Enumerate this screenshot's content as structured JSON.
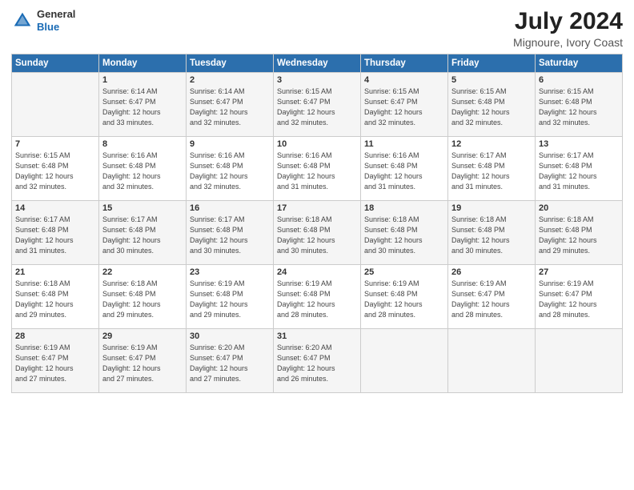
{
  "logo": {
    "general": "General",
    "blue": "Blue"
  },
  "title": "July 2024",
  "location": "Mignoure, Ivory Coast",
  "days_of_week": [
    "Sunday",
    "Monday",
    "Tuesday",
    "Wednesday",
    "Thursday",
    "Friday",
    "Saturday"
  ],
  "weeks": [
    [
      {
        "day": "",
        "sunrise": "",
        "sunset": "",
        "daylight": ""
      },
      {
        "day": "1",
        "sunrise": "Sunrise: 6:14 AM",
        "sunset": "Sunset: 6:47 PM",
        "daylight": "Daylight: 12 hours and 33 minutes."
      },
      {
        "day": "2",
        "sunrise": "Sunrise: 6:14 AM",
        "sunset": "Sunset: 6:47 PM",
        "daylight": "Daylight: 12 hours and 32 minutes."
      },
      {
        "day": "3",
        "sunrise": "Sunrise: 6:15 AM",
        "sunset": "Sunset: 6:47 PM",
        "daylight": "Daylight: 12 hours and 32 minutes."
      },
      {
        "day": "4",
        "sunrise": "Sunrise: 6:15 AM",
        "sunset": "Sunset: 6:47 PM",
        "daylight": "Daylight: 12 hours and 32 minutes."
      },
      {
        "day": "5",
        "sunrise": "Sunrise: 6:15 AM",
        "sunset": "Sunset: 6:48 PM",
        "daylight": "Daylight: 12 hours and 32 minutes."
      },
      {
        "day": "6",
        "sunrise": "Sunrise: 6:15 AM",
        "sunset": "Sunset: 6:48 PM",
        "daylight": "Daylight: 12 hours and 32 minutes."
      }
    ],
    [
      {
        "day": "7",
        "sunrise": "Sunrise: 6:15 AM",
        "sunset": "Sunset: 6:48 PM",
        "daylight": "Daylight: 12 hours and 32 minutes."
      },
      {
        "day": "8",
        "sunrise": "Sunrise: 6:16 AM",
        "sunset": "Sunset: 6:48 PM",
        "daylight": "Daylight: 12 hours and 32 minutes."
      },
      {
        "day": "9",
        "sunrise": "Sunrise: 6:16 AM",
        "sunset": "Sunset: 6:48 PM",
        "daylight": "Daylight: 12 hours and 32 minutes."
      },
      {
        "day": "10",
        "sunrise": "Sunrise: 6:16 AM",
        "sunset": "Sunset: 6:48 PM",
        "daylight": "Daylight: 12 hours and 31 minutes."
      },
      {
        "day": "11",
        "sunrise": "Sunrise: 6:16 AM",
        "sunset": "Sunset: 6:48 PM",
        "daylight": "Daylight: 12 hours and 31 minutes."
      },
      {
        "day": "12",
        "sunrise": "Sunrise: 6:17 AM",
        "sunset": "Sunset: 6:48 PM",
        "daylight": "Daylight: 12 hours and 31 minutes."
      },
      {
        "day": "13",
        "sunrise": "Sunrise: 6:17 AM",
        "sunset": "Sunset: 6:48 PM",
        "daylight": "Daylight: 12 hours and 31 minutes."
      }
    ],
    [
      {
        "day": "14",
        "sunrise": "Sunrise: 6:17 AM",
        "sunset": "Sunset: 6:48 PM",
        "daylight": "Daylight: 12 hours and 31 minutes."
      },
      {
        "day": "15",
        "sunrise": "Sunrise: 6:17 AM",
        "sunset": "Sunset: 6:48 PM",
        "daylight": "Daylight: 12 hours and 30 minutes."
      },
      {
        "day": "16",
        "sunrise": "Sunrise: 6:17 AM",
        "sunset": "Sunset: 6:48 PM",
        "daylight": "Daylight: 12 hours and 30 minutes."
      },
      {
        "day": "17",
        "sunrise": "Sunrise: 6:18 AM",
        "sunset": "Sunset: 6:48 PM",
        "daylight": "Daylight: 12 hours and 30 minutes."
      },
      {
        "day": "18",
        "sunrise": "Sunrise: 6:18 AM",
        "sunset": "Sunset: 6:48 PM",
        "daylight": "Daylight: 12 hours and 30 minutes."
      },
      {
        "day": "19",
        "sunrise": "Sunrise: 6:18 AM",
        "sunset": "Sunset: 6:48 PM",
        "daylight": "Daylight: 12 hours and 30 minutes."
      },
      {
        "day": "20",
        "sunrise": "Sunrise: 6:18 AM",
        "sunset": "Sunset: 6:48 PM",
        "daylight": "Daylight: 12 hours and 29 minutes."
      }
    ],
    [
      {
        "day": "21",
        "sunrise": "Sunrise: 6:18 AM",
        "sunset": "Sunset: 6:48 PM",
        "daylight": "Daylight: 12 hours and 29 minutes."
      },
      {
        "day": "22",
        "sunrise": "Sunrise: 6:18 AM",
        "sunset": "Sunset: 6:48 PM",
        "daylight": "Daylight: 12 hours and 29 minutes."
      },
      {
        "day": "23",
        "sunrise": "Sunrise: 6:19 AM",
        "sunset": "Sunset: 6:48 PM",
        "daylight": "Daylight: 12 hours and 29 minutes."
      },
      {
        "day": "24",
        "sunrise": "Sunrise: 6:19 AM",
        "sunset": "Sunset: 6:48 PM",
        "daylight": "Daylight: 12 hours and 28 minutes."
      },
      {
        "day": "25",
        "sunrise": "Sunrise: 6:19 AM",
        "sunset": "Sunset: 6:48 PM",
        "daylight": "Daylight: 12 hours and 28 minutes."
      },
      {
        "day": "26",
        "sunrise": "Sunrise: 6:19 AM",
        "sunset": "Sunset: 6:47 PM",
        "daylight": "Daylight: 12 hours and 28 minutes."
      },
      {
        "day": "27",
        "sunrise": "Sunrise: 6:19 AM",
        "sunset": "Sunset: 6:47 PM",
        "daylight": "Daylight: 12 hours and 28 minutes."
      }
    ],
    [
      {
        "day": "28",
        "sunrise": "Sunrise: 6:19 AM",
        "sunset": "Sunset: 6:47 PM",
        "daylight": "Daylight: 12 hours and 27 minutes."
      },
      {
        "day": "29",
        "sunrise": "Sunrise: 6:19 AM",
        "sunset": "Sunset: 6:47 PM",
        "daylight": "Daylight: 12 hours and 27 minutes."
      },
      {
        "day": "30",
        "sunrise": "Sunrise: 6:20 AM",
        "sunset": "Sunset: 6:47 PM",
        "daylight": "Daylight: 12 hours and 27 minutes."
      },
      {
        "day": "31",
        "sunrise": "Sunrise: 6:20 AM",
        "sunset": "Sunset: 6:47 PM",
        "daylight": "Daylight: 12 hours and 26 minutes."
      },
      {
        "day": "",
        "sunrise": "",
        "sunset": "",
        "daylight": ""
      },
      {
        "day": "",
        "sunrise": "",
        "sunset": "",
        "daylight": ""
      },
      {
        "day": "",
        "sunrise": "",
        "sunset": "",
        "daylight": ""
      }
    ]
  ]
}
